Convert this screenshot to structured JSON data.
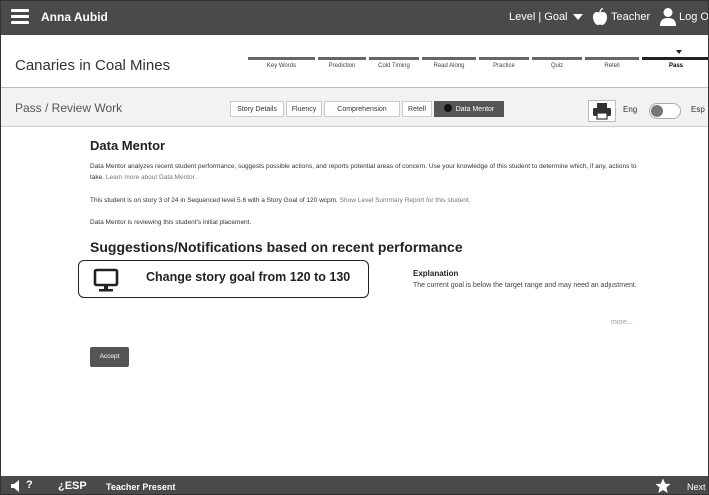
{
  "topbar": {
    "user_name": "Anna Aubid",
    "level_menu": "Level | Goal",
    "teacher": "Teacher",
    "logout": "Log Out"
  },
  "story": {
    "title": "Canaries in Coal Mines",
    "steps": [
      "Key Words",
      "Prediction",
      "Cold Timing",
      "Read Along",
      "Practice",
      "Quiz",
      "Retell",
      "Pass"
    ],
    "active_step": "Pass"
  },
  "pass_bar": {
    "breadcrumb": "Pass / Review Work",
    "tabs": [
      "Story Details",
      "Fluency",
      "Comprehension",
      "Retell",
      "Data Mentor"
    ],
    "active_tab": "Data Mentor",
    "lang_eng": "Eng",
    "lang_esp": "Esp"
  },
  "content": {
    "title": "Data Mentor",
    "intro_text": "Data Mentor analyzes recent student performance, suggests possible actions, and reports potential areas of concern. Use your knowledge of this student to determine which, if any, actions to take.",
    "intro_link": "Learn more about Data Mentor.",
    "story_text": "This student is on story 3 of 24 in Sequenced level 5.6 with a Story Goal of 120 wcpm.",
    "story_link": "Show Level Summary Report for this student.",
    "reviewing_text": "Data Mentor is reviewing this student's initial placement.",
    "suggestions_heading": "Suggestions/Notifications based on recent performance",
    "suggestion": "Change story goal from 120 to 130",
    "explanation_title": "Explanation",
    "explanation_text": "The current goal is below the target range and may need an adjustment.",
    "more": "more...",
    "accept": "Accept"
  },
  "bottombar": {
    "help_mark": "?",
    "esp": "¿ESP",
    "teacher_present": "Teacher Present",
    "next": "Next"
  }
}
